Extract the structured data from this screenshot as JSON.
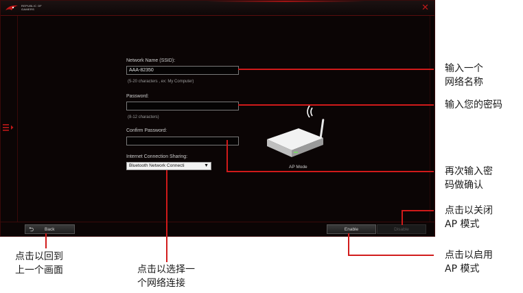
{
  "window": {
    "logo_line1": "REPUBLIC OF",
    "logo_line2": "GAMERS",
    "close_glyph": "✕"
  },
  "form": {
    "ssid_label": "Network Name (SSID):",
    "ssid_value": "AAA-82350",
    "ssid_hint": "(5-20 characters , ex: My Computer)",
    "password_label": "Password:",
    "password_value": "",
    "password_hint": "(8-12 characters)",
    "confirm_label": "Confirm Password:",
    "confirm_value": "",
    "sharing_label": "Internet Connection Sharing:",
    "sharing_selected": "Bluetooth Network Connecti",
    "ap_mode_label": "AP Mode"
  },
  "buttons": {
    "back": "Back",
    "enable": "Enable",
    "disable": "Disable"
  },
  "icons": {
    "menu": "menu-expand-icon",
    "back": "back-arrow-icon",
    "router": "wireless-router-icon",
    "dropdown": "caret-down-icon"
  },
  "annotations": {
    "ssid_line1": "输入一个",
    "ssid_line2": "网络名称",
    "password": "输入您的密码",
    "confirm_line1": "再次输入密",
    "confirm_line2": "码做确认",
    "disable_line1": "点击以关闭",
    "disable_line2": "AP 模式",
    "enable_line1": "点击以启用",
    "enable_line2": "AP 模式",
    "back_line1": "点击以回到",
    "back_line2": "上一个画面",
    "select_line1": "点击以选择一",
    "select_line2": "个网络连接"
  },
  "colors": {
    "accent_red": "#d11a1a",
    "window_bg": "#0b0505"
  }
}
